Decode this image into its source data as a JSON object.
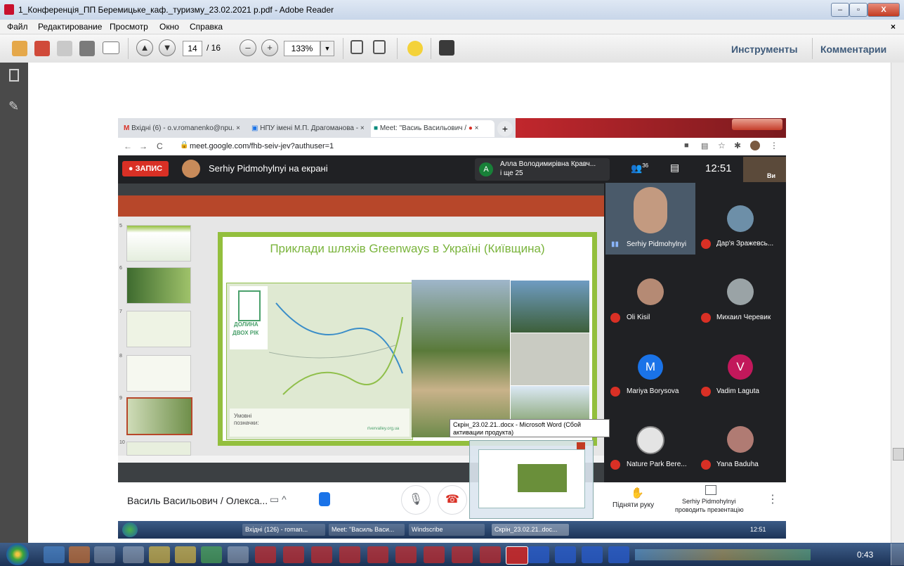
{
  "window": {
    "title": "1_Конференція_ПП Беремицьке_каф._туризму_23.02.2021 р.pdf - Adobe Reader",
    "minimize": "–",
    "maximize": "▫",
    "close": "X"
  },
  "menubar": {
    "items": [
      "Файл",
      "Редактирование",
      "Просмотр",
      "Окно",
      "Справка"
    ],
    "close_doc": "×"
  },
  "toolbar": {
    "page_current": "14",
    "page_total": "/ 16",
    "zoom": "133%",
    "tools_label": "Инструменты",
    "comments_label": "Комментарии"
  },
  "chrome": {
    "tabs": [
      {
        "label": "Вхідні (6) - o.v.romanenko@npu.",
        "close": "×"
      },
      {
        "label": "НПУ імені М.П. Драгоманова -",
        "close": "×"
      },
      {
        "label": "Meet: \"Васиь Васильович /",
        "close": "×"
      }
    ],
    "new_tab": "+",
    "url": "meet.google.com/fhb-seiv-jev?authuser=1"
  },
  "meet": {
    "record_label": "ЗАПИС",
    "presenter_banner": "Serhiy Pidmohylnyi на екрані",
    "attendee_initial": "A",
    "attendee_name": "Алла Володимирівна Кравч...",
    "attendee_more": "і ще 25",
    "people_count": "36",
    "time": "12:51",
    "self_label": "Ви",
    "participants": [
      {
        "name": "Serhiy Pidmohylnyi",
        "avatar": ""
      },
      {
        "name": "Дар'я Зражевсь...",
        "avatar": ""
      },
      {
        "name": "Oli Kisil",
        "avatar": ""
      },
      {
        "name": "Михаил Черевик",
        "avatar": ""
      },
      {
        "name": "Mariya Borysova",
        "avatar": "M",
        "color": "#1a73e8"
      },
      {
        "name": "Vadim Laguta",
        "avatar": "V",
        "color": "#c2185b"
      },
      {
        "name": "Nature Park Bere...",
        "avatar": ""
      },
      {
        "name": "Yana Baduha",
        "avatar": ""
      }
    ],
    "bottom": {
      "meeting_name": "Василь Васильович / Олекса...",
      "raise_hand": "Підняти руку",
      "presenting_line1": "Serhiy Pidmohylnyi",
      "presenting_line2": "проводить презентацію"
    }
  },
  "slide": {
    "title": "Приклади шляхів Greenways в Україні (Київщина)",
    "logo_line1": "ДОЛИНА",
    "logo_line2": "ДВОХ РІК",
    "legend_title_1": "Умовні",
    "legend_title_2": "позначки:",
    "site": "rivervalley.org.ua",
    "thumb_numbers": [
      "5",
      "6",
      "7",
      "8",
      "9",
      "10"
    ]
  },
  "inner_taskbar": {
    "items": [
      "Вхідні (126) - roman...",
      "Meet: \"Василь Васи...",
      "Windscribe",
      "Скрін_23.02.21..doc..."
    ],
    "time": "12:51"
  },
  "tooltip": {
    "text": "Скрін_23.02.21..docx - Microsoft Word (Сбой активации продукта)"
  },
  "taskbar": {
    "time": "0:43"
  },
  "colors": {
    "meet_red": "#d93025",
    "slide_green": "#93bf3d",
    "ppt_red": "#b7472a",
    "adobe_link": "#3e5a7a"
  }
}
